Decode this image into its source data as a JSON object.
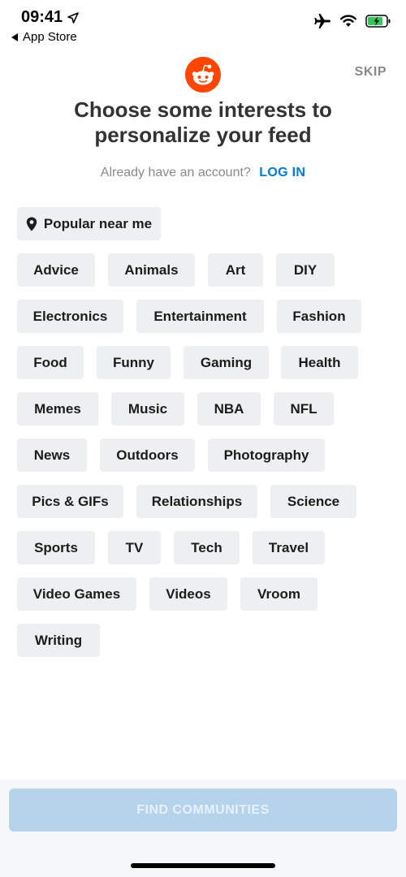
{
  "status_bar": {
    "time": "09:41",
    "back_label": "App Store",
    "icons": [
      "location-arrow-icon",
      "airplane-icon",
      "wifi-icon",
      "battery-charging-icon"
    ]
  },
  "header": {
    "logo_icon": "reddit-logo-icon",
    "skip_label": "SKIP",
    "title_line1": "Choose some interests to",
    "title_line2": "personalize your feed",
    "account_prompt": "Already have an account?",
    "login_label": "LOG IN"
  },
  "interests": {
    "popular": "Popular near me",
    "items": [
      "Advice",
      "Animals",
      "Art",
      "DIY",
      "Electronics",
      "Entertainment",
      "Fashion",
      "Food",
      "Funny",
      "Gaming",
      "Health",
      "Memes",
      "Music",
      "NBA",
      "NFL",
      "News",
      "Outdoors",
      "Photography",
      "Pics & GIFs",
      "Relationships",
      "Science",
      "Sports",
      "TV",
      "Tech",
      "Travel",
      "Video Games",
      "Videos",
      "Vroom",
      "Writing"
    ]
  },
  "footer": {
    "cta_label": "FIND COMMUNITIES"
  },
  "colors": {
    "brand": "#ff4500",
    "link": "#0079d3",
    "chip_bg": "#edeff1",
    "cta_disabled": "#b5d3ea"
  }
}
